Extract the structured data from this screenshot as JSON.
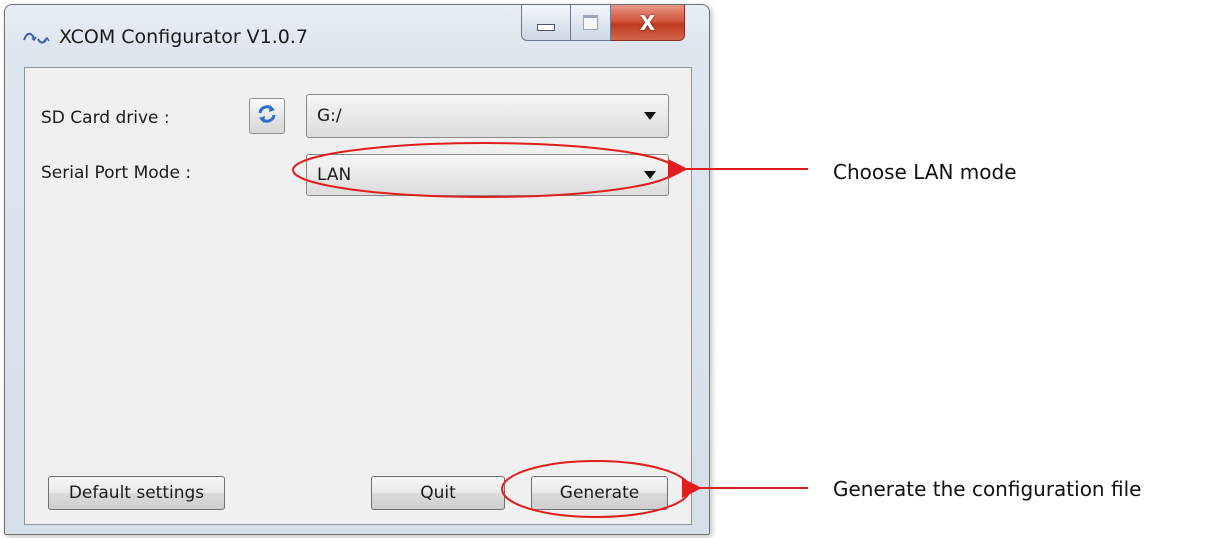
{
  "window": {
    "title": "XCOM Configurator V1.0.7",
    "app_icon": "xcom-app-icon",
    "caption_buttons": {
      "minimize_icon": "minimize-icon",
      "maximize_icon": "maximize-icon",
      "close_icon": "close-icon",
      "close_glyph": "X"
    }
  },
  "form": {
    "sd_card": {
      "label": "SD Card drive :",
      "refresh_icon": "refresh-icon",
      "selected": "G:/"
    },
    "serial_port": {
      "label": "Serial Port Mode :",
      "selected": "LAN"
    }
  },
  "buttons": {
    "default_settings": "Default settings",
    "quit": "Quit",
    "generate": "Generate"
  },
  "annotations": {
    "lan_note": "Choose LAN mode",
    "generate_note": "Generate the configuration file",
    "highlight_color": "#e01e1e",
    "arrow_color": "#e01e1e"
  },
  "colors": {
    "window_frame": "#d6dee9",
    "client_background": "#f0f0f0",
    "close_button": "#c13a22",
    "refresh_icon": "#2f6fc9"
  }
}
